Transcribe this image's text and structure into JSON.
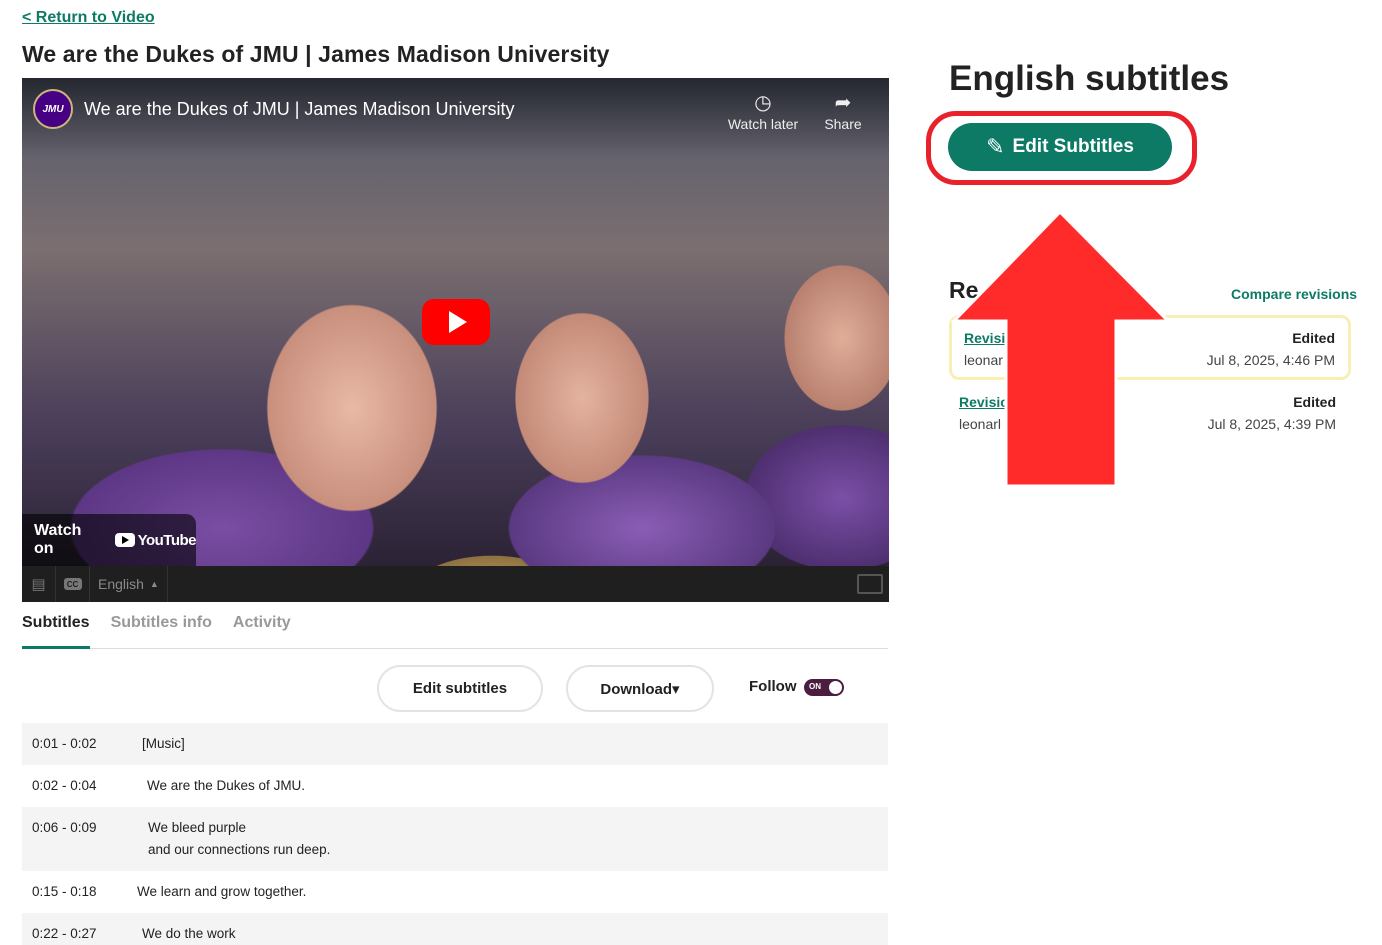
{
  "nav": {
    "back_link": "< Return to Video"
  },
  "video": {
    "page_title": "We are the Dukes of JMU | James Madison University",
    "embed_title": "We are the Dukes of JMU | James Madison University",
    "channel_logo": "JMU",
    "watch_later": "Watch later",
    "share": "Share",
    "watch_on": "Watch on",
    "youtube": "YouTube"
  },
  "player": {
    "language": "English"
  },
  "tabs": [
    {
      "label": "Subtitles",
      "active": true
    },
    {
      "label": "Subtitles info",
      "active": false
    },
    {
      "label": "Activity",
      "active": false
    }
  ],
  "toolbar": {
    "edit_label": "Edit subtitles",
    "download_label": "Download▾",
    "follow_label": "Follow",
    "toggle_label": "ON"
  },
  "subtitles": [
    {
      "time": "0:01 - 0:02",
      "lines": [
        "[Music]"
      ]
    },
    {
      "time": "0:02 - 0:04",
      "lines": [
        "We are the Dukes of JMU."
      ]
    },
    {
      "time": "0:06 - 0:09",
      "lines": [
        "We bleed purple",
        "and our connections run deep."
      ]
    },
    {
      "time": "0:15 - 0:18",
      "lines": [
        "We learn and grow together."
      ]
    },
    {
      "time": "0:22 - 0:27",
      "lines": [
        "We do the work"
      ]
    }
  ],
  "panel": {
    "title": "English subtitles",
    "edit_button": "Edit Subtitles",
    "revisions_heading": "Re",
    "compare_link": "Compare revisions",
    "revisions": [
      {
        "link": "Revisio",
        "user": "leonar",
        "status": "Edited",
        "date": "Jul 8, 2025, 4:46 PM"
      },
      {
        "link": "Revisio",
        "user": "leonarl",
        "status": "Edited",
        "date": "Jul 8, 2025, 4:39 PM"
      }
    ]
  },
  "colors": {
    "accent": "#0d7a66",
    "annotation": "#e8212b",
    "arrow": "#ff2b2b",
    "revision_highlight": "#f6f0b5"
  }
}
